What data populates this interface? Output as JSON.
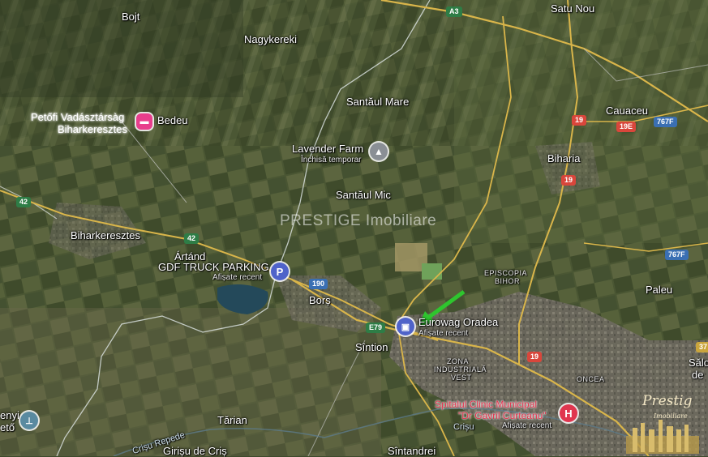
{
  "places": {
    "bojt": "Bojt",
    "nagykereki": "Nagykereki",
    "satu_nou": "Satu Nou",
    "santaul_mare": "Santăul Mare",
    "cauaceu": "Cauaceu",
    "biharia": "Biharia",
    "petofi_line1": "Petőfi Vadásztársàg",
    "petofi_line2": "Biharkeresztes",
    "bedeu": "Bedeu",
    "lavender_farm": "Lavender Farm",
    "lavender_status": "Închisă temporar",
    "santaul_mic": "Santăul Mic",
    "biharkeresztes": "Biharkeresztes",
    "artand": "Ártánd",
    "gdf_truck": "GDF TRUCK PARKING",
    "gdf_recent": "Afișate recent",
    "episcopia_bihor_1": "EPISCOPIA",
    "episcopia_bihor_2": "BIHOR",
    "paleu": "Paleu",
    "bors": "Borș",
    "eurowag": "Eurowag Oradea",
    "eurowag_recent": "Afișate recent",
    "sintion": "Sîntion",
    "zona_1": "ZONA",
    "zona_2": "INDUSTRIALĂ",
    "zona_3": "VEST",
    "oncea": "ONCEA",
    "salo_1": "Sălo",
    "salo_2": "de",
    "spitalul_1": "Spitalul Clinic Municipal",
    "spitalul_2": "\"Dr Gavril Curteanu\"",
    "spitalul_recent": "Afișate recent",
    "crisu": "Crișu",
    "enyi_1": "enyi",
    "enyi_2": "ető",
    "tarian": "Tărian",
    "crisu_repede": "Crișu Repede",
    "girisu": "Girișu de Criș",
    "sintandrei": "Sîntandrei"
  },
  "roads": {
    "a3": "A3",
    "r19_a": "19",
    "r19e": "19E",
    "r767f_a": "767F",
    "r19_b": "19",
    "r42_a": "42",
    "r42_b": "42",
    "r767f_b": "767F",
    "r190": "190",
    "e79": "E79",
    "r19_c": "19",
    "r37": "37"
  },
  "pins": {
    "bedeu_icon": "hotel-icon",
    "lavender_icon": "tree-icon",
    "gdf_icon": "P",
    "eurowag_icon": "fuel-icon",
    "hospital_icon": "H",
    "enyi_icon": "landmark-icon"
  },
  "watermark": "PRESTIGE Imobiliare",
  "logo": {
    "line1": "Prestig",
    "line2": "Imobiliare"
  },
  "colors": {
    "road_yellow": "#d9b54a",
    "border_white": "#dfe6e6",
    "arrow_green": "#2ec52e",
    "pin_blue": "#4f63c9",
    "pin_red": "#e0364f",
    "pin_pink": "#e83e8c",
    "pin_gray": "#8a8f95",
    "pin_teal": "#5a8aa0"
  }
}
